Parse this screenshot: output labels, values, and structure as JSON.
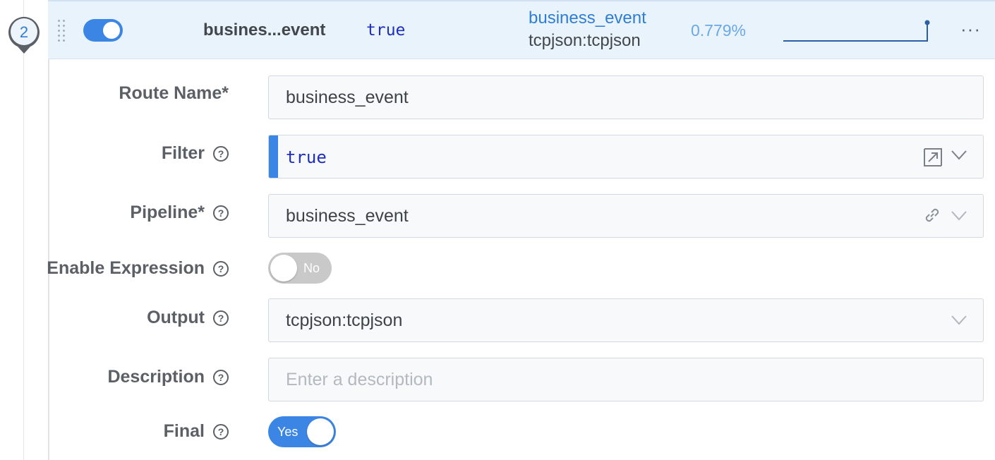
{
  "route": {
    "index": "2",
    "enabled": true,
    "name_short": "busines...event",
    "filter": "true",
    "pipeline": "business_event",
    "output": "tcpjson:tcpjson",
    "percentage": "0.779%",
    "sparkline": [
      0,
      0,
      0,
      0,
      0,
      0,
      0,
      0,
      0,
      0,
      1
    ]
  },
  "form": {
    "route_name": {
      "label": "Route Name*",
      "value": "business_event"
    },
    "filter": {
      "label": "Filter",
      "value": "true"
    },
    "pipeline": {
      "label": "Pipeline*",
      "value": "business_event"
    },
    "enable_expression": {
      "label": "Enable Expression",
      "state": "No"
    },
    "output": {
      "label": "Output",
      "value": "tcpjson:tcpjson"
    },
    "description": {
      "label": "Description",
      "placeholder": "Enter a description"
    },
    "final": {
      "label": "Final",
      "state": "Yes"
    }
  },
  "help_glyph": "?",
  "more_glyph": "···",
  "colors": {
    "accent": "#3b86e4",
    "header_bg": "#e9f3fb",
    "mono_text": "#1f2fb8"
  }
}
